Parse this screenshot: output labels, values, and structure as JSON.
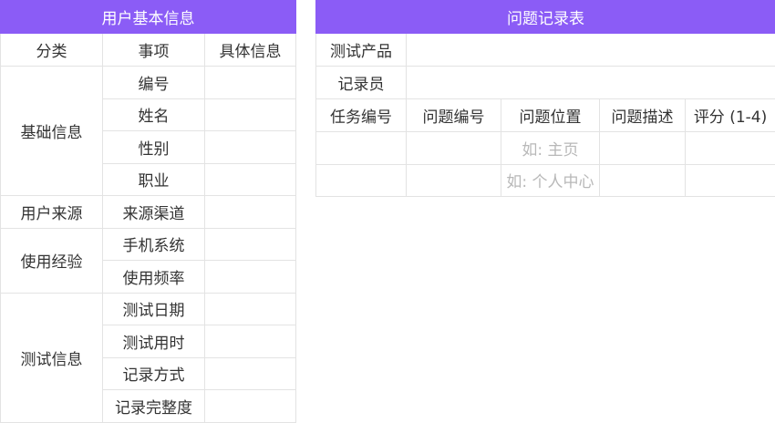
{
  "left_table": {
    "title": "用户基本信息",
    "headers": [
      "分类",
      "事项",
      "具体信息"
    ],
    "groups": [
      {
        "category": "基础信息",
        "items": [
          "编号",
          "姓名",
          "性别",
          "职业"
        ]
      },
      {
        "category": "用户来源",
        "items": [
          "来源渠道"
        ]
      },
      {
        "category": "使用经验",
        "items": [
          "手机系统",
          "使用频率"
        ]
      },
      {
        "category": "测试信息",
        "items": [
          "测试日期",
          "测试用时",
          "记录方式",
          "记录完整度"
        ]
      }
    ]
  },
  "right_table": {
    "title": "问题记录表",
    "product_label": "测试产品",
    "recorder_label": "记录员",
    "headers": [
      "任务编号",
      "问题编号",
      "问题位置",
      "问题描述",
      "评分 (1-4)"
    ],
    "rows": [
      {
        "location_placeholder": "如: 主页"
      },
      {
        "location_placeholder": "如: 个人中心"
      }
    ]
  },
  "colors": {
    "header_bg": "#8b5cf6",
    "border": "#e3e3e3",
    "placeholder": "#b8b8b8"
  }
}
